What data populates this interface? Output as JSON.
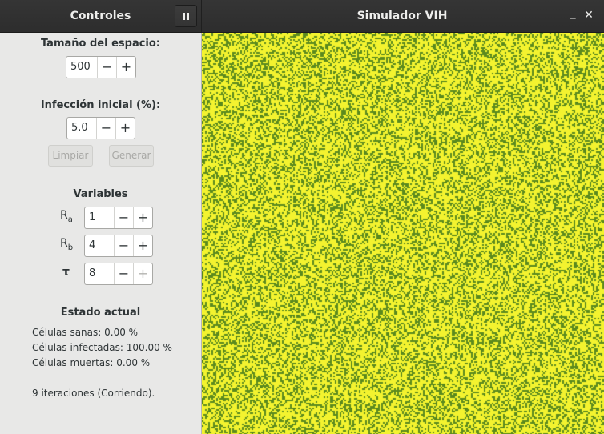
{
  "titlebar": {
    "left_title": "Controles",
    "main_title": "Simulador VIH",
    "minimize_glyph": "_",
    "close_glyph": "✕"
  },
  "space": {
    "label": "Tamaño del espacio:",
    "value": "500"
  },
  "infection": {
    "label": "Infección inicial (%):",
    "value": "5.0"
  },
  "buttons": {
    "clear": "Limpiar",
    "generate": "Generar"
  },
  "variables": {
    "heading": "Variables",
    "ra": {
      "label": "R",
      "sub": "a",
      "value": "1"
    },
    "rb": {
      "label": "R",
      "sub": "b",
      "value": "4"
    },
    "tau": {
      "label": "τ",
      "value": "8"
    }
  },
  "status": {
    "heading": "Estado actual",
    "healthy": "Células sanas: 0.00 %",
    "infected": "Células infectadas: 100.00 %",
    "dead": "Células muertas: 0.00 %",
    "iterations": "9 iteraciones (Corriendo)."
  },
  "colors": {
    "grid_background": "#f3f32f",
    "cell_infected": "#5b8a1e"
  },
  "icons": {
    "pause": "pause-icon",
    "minus": "minus-icon",
    "plus": "plus-icon"
  }
}
